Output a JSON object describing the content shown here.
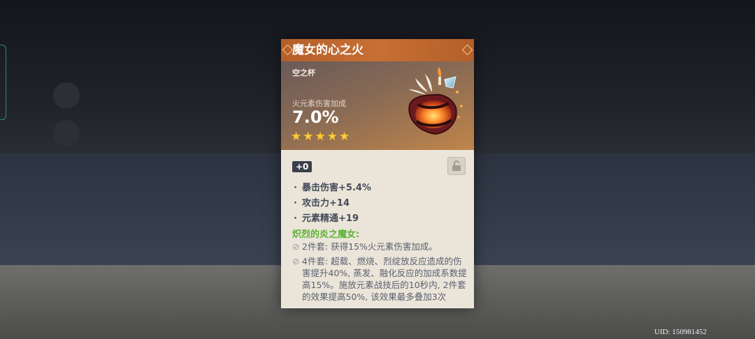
{
  "artifact": {
    "name": "魔女的心之火",
    "slot": "空之杯",
    "main_stat": {
      "label": "火元素伤害加成",
      "value": "7.0%"
    },
    "rarity_stars": 5,
    "level": "+0",
    "locked": false,
    "substats": [
      "暴击伤害+5.4%",
      "攻击力+14",
      "元素精通+19"
    ],
    "set": {
      "name": "炽烈的炎之魔女:",
      "two_piece": "2件套: 获得15%火元素伤害加成。",
      "four_piece": "4件套: 超载、燃烧、烈绽放反应造成的伤害提升40%, 蒸发、融化反应的加成系数提高15%。施放元素战技后的10秒内, 2件套的效果提高50%, 该效果最多叠加3次"
    }
  },
  "colors": {
    "title_bar": "#c76f34",
    "set_name": "#5cb233",
    "star": "#ffcc33"
  },
  "icons": {
    "star": "star-icon",
    "lock": "lock-icon",
    "bullet": "bullet-icon",
    "set_inactive": "circle-slash-icon"
  },
  "footer": {
    "uid": "UID: 150981452"
  }
}
